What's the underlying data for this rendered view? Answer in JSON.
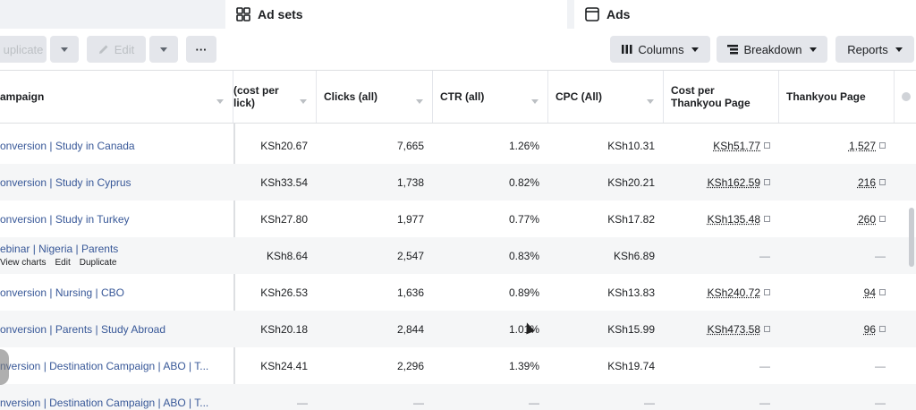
{
  "tabs": {
    "adsets_label": "Ad sets",
    "ads_label": "Ads"
  },
  "toolbar": {
    "duplicate_label": "uplicate",
    "edit_label": "Edit",
    "more_label": "···",
    "columns_label": "Columns",
    "breakdown_label": "Breakdown",
    "reports_label": "Reports"
  },
  "columns": {
    "campaign": "ampaign",
    "cpc_link": "(cost per\nlick)",
    "clicks": "Clicks (all)",
    "ctr": "CTR (all)",
    "cpc_all": "CPC (All)",
    "cost_per_thankyou": "Cost per Thankyou Page",
    "thankyou": "Thankyou Page"
  },
  "rows": [
    {
      "name": "onversion | Study in Canada",
      "cpc_link": "KSh20.67",
      "clicks": "7,665",
      "ctr": "1.26%",
      "cpc_all": "KSh10.31",
      "cost_ty": "KSh51.77",
      "ty": "1,527"
    },
    {
      "name": "onversion | Study in Cyprus",
      "cpc_link": "KSh33.54",
      "clicks": "1,738",
      "ctr": "0.82%",
      "cpc_all": "KSh20.21",
      "cost_ty": "KSh162.59",
      "ty": "216"
    },
    {
      "name": "onversion | Study in Turkey",
      "cpc_link": "KSh27.80",
      "clicks": "1,977",
      "ctr": "0.77%",
      "cpc_all": "KSh17.82",
      "cost_ty": "KSh135.48",
      "ty": "260"
    },
    {
      "name": "ebinar | Nigeria | Parents",
      "cpc_link": "KSh8.64",
      "clicks": "2,547",
      "ctr": "0.83%",
      "cpc_all": "KSh6.89",
      "cost_ty": "—",
      "ty": "—"
    },
    {
      "name": "onversion | Nursing | CBO",
      "cpc_link": "KSh26.53",
      "clicks": "1,636",
      "ctr": "0.89%",
      "cpc_all": "KSh13.83",
      "cost_ty": "KSh240.72",
      "ty": "94"
    },
    {
      "name": "onversion | Parents | Study Abroad",
      "cpc_link": "KSh20.18",
      "clicks": "2,844",
      "ctr": "1.01%",
      "cpc_all": "KSh15.99",
      "cost_ty": "KSh473.58",
      "ty": "96"
    },
    {
      "name": "nversion | Destination Campaign | ABO | T...",
      "cpc_link": "KSh24.41",
      "clicks": "2,296",
      "ctr": "1.39%",
      "cpc_all": "KSh19.74",
      "cost_ty": "—",
      "ty": "—"
    },
    {
      "name": "nversion | Destination Campaign | ABO | T...",
      "cpc_link": "—",
      "clicks": "—",
      "ctr": "—",
      "cpc_all": "—",
      "cost_ty": "—",
      "ty": "—"
    }
  ],
  "hover_actions": {
    "view_charts": "View charts",
    "edit": "Edit",
    "duplicate": "Duplicate"
  },
  "icons": {
    "adsets": "ad-sets-grid-icon",
    "ads": "ads-square-icon",
    "edit": "pencil-icon",
    "columns": "columns-icon",
    "breakdown": "breakdown-icon"
  },
  "colors": {
    "link": "#385898",
    "button_bg": "#e4e6eb",
    "row_alt": "#f5f6f7"
  }
}
